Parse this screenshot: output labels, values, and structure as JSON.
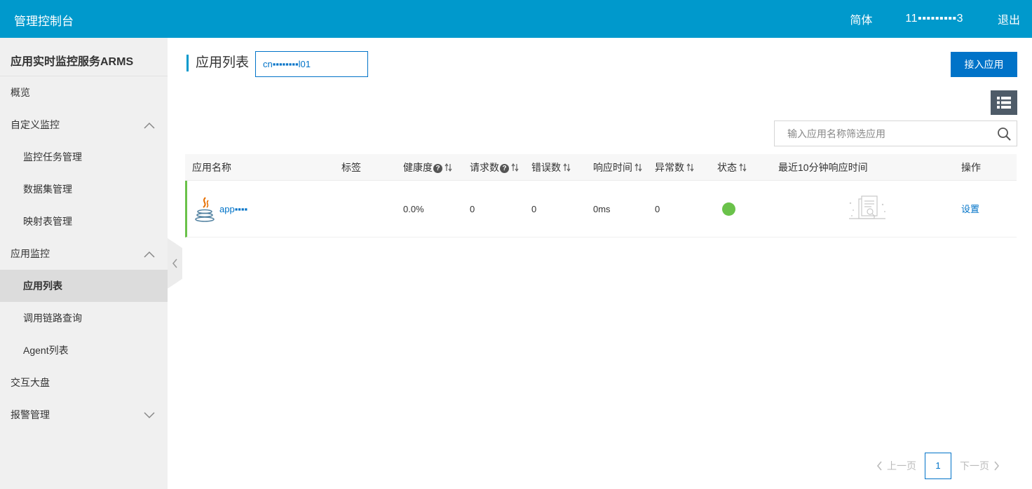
{
  "topbar": {
    "brand": "管理控制台",
    "lang": "简体",
    "user": "11▪▪▪▪▪▪▪▪▪3",
    "logout": "退出"
  },
  "sidebar": {
    "title": "应用实时监控服务ARMS",
    "items": [
      {
        "label": "概览"
      },
      {
        "label": "自定义监控",
        "expanded": true
      },
      {
        "label": "监控任务管理"
      },
      {
        "label": "数据集管理"
      },
      {
        "label": "映射表管理"
      },
      {
        "label": "应用监控",
        "expanded": true
      },
      {
        "label": "应用列表",
        "active": true
      },
      {
        "label": "调用链路查询"
      },
      {
        "label": "Agent列表"
      },
      {
        "label": "交互大盘"
      },
      {
        "label": "报警管理",
        "expanded": false
      }
    ]
  },
  "main": {
    "title": "应用列表",
    "region": "cn▪▪▪▪▪▪▪▪l01",
    "add_button": "接入应用",
    "view_toggle_icon": "list-view-icon",
    "search_placeholder": "输入应用名称筛选应用",
    "table": {
      "headers": [
        "应用名称",
        "标签",
        "健康度",
        "请求数",
        "错误数",
        "响应时间",
        "异常数",
        "状态",
        "最近10分钟响应时间",
        "操作"
      ],
      "rows": [
        {
          "name": "app▪▪▪▪",
          "tag": "",
          "health": "0.0%",
          "requests": "0",
          "errors": "0",
          "response_time": "0ms",
          "exceptions": "0",
          "status": "green",
          "action": "设置",
          "icon": "java-icon"
        }
      ]
    },
    "pager": {
      "prev": "上一页",
      "current": "1",
      "next": "下一页"
    }
  },
  "colors": {
    "topbar": "#0099cc",
    "primary": "#0073c8",
    "status_ok": "#6ac24a"
  }
}
